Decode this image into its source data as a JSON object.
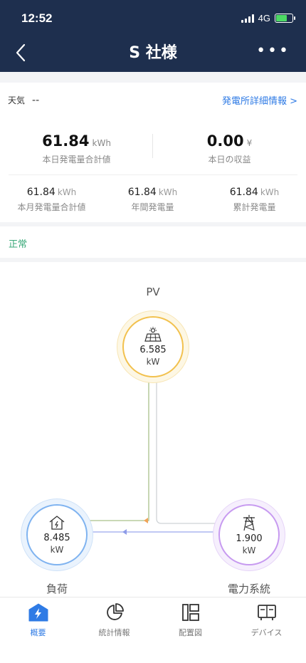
{
  "status_bar": {
    "time": "12:52",
    "network": "4G"
  },
  "header": {
    "title": "S 社様"
  },
  "summary": {
    "weather_label": "天気",
    "weather_value": "--",
    "detail_link": "発電所詳細情報 >",
    "today_generation": {
      "value": "61.84",
      "unit": "kWh",
      "label": "本日発電量合計値"
    },
    "today_revenue": {
      "value": "0.00",
      "unit": "¥",
      "label": "本日の収益"
    },
    "month_generation": {
      "value": "61.84",
      "unit": "kWh",
      "label": "本月発電量合計値"
    },
    "year_generation": {
      "value": "61.84",
      "unit": "kWh",
      "label": "年間発電量"
    },
    "total_generation": {
      "value": "61.84",
      "unit": "kWh",
      "label": "累計発電量"
    }
  },
  "status": {
    "text": "正常"
  },
  "flow": {
    "pv": {
      "label": "PV",
      "value": "6.585",
      "unit": "kW",
      "icon": "solar-panel-icon"
    },
    "load": {
      "label": "負荷",
      "value": "8.485",
      "unit": "kW",
      "icon": "house-icon"
    },
    "grid": {
      "label": "電力系統",
      "value": "1.900",
      "unit": "kW",
      "icon": "power-tower-icon"
    }
  },
  "colors": {
    "header_bg": "#1e2f4e",
    "accent": "#2f7be5",
    "status_ok": "#3aa979",
    "pv_ring": "#f2c14e",
    "load_ring": "#7fb3f0",
    "grid_ring": "#c79af0"
  },
  "tabs": [
    {
      "label": "概要",
      "icon": "overview-bolt-icon",
      "active": true
    },
    {
      "label": "統計情報",
      "icon": "pie-chart-icon",
      "active": false
    },
    {
      "label": "配置図",
      "icon": "layout-icon",
      "active": false
    },
    {
      "label": "デバイス",
      "icon": "device-icon",
      "active": false
    }
  ]
}
